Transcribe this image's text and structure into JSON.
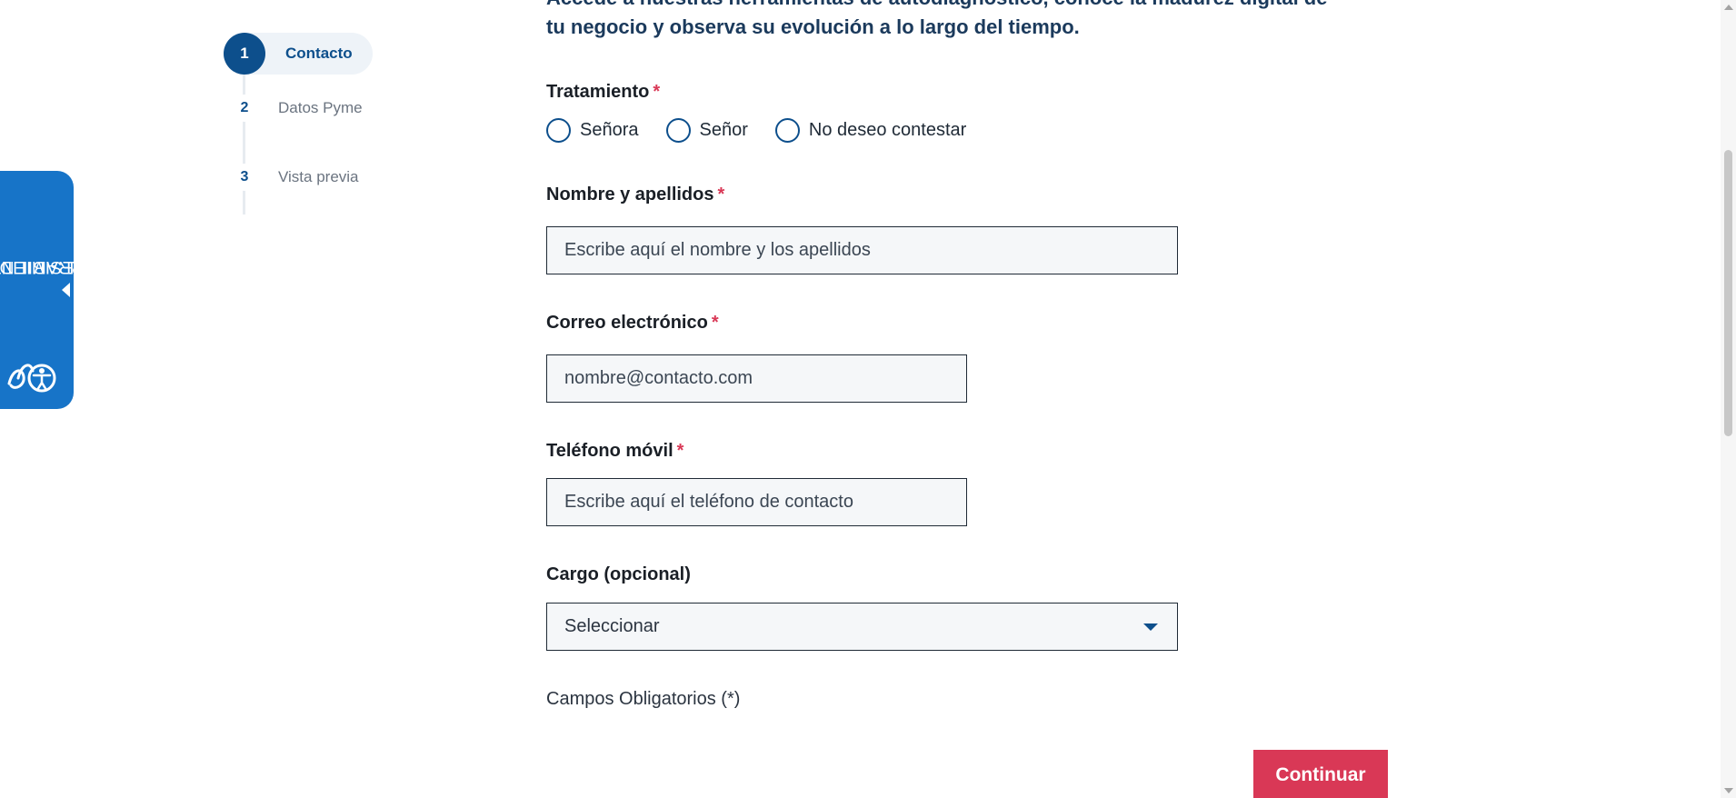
{
  "intro": {
    "line1": "Accede a nuestras herramientas de autodiagnóstico, conoce la madurez digital de",
    "line2": "tu negocio y observa su evolución a lo largo del tiempo."
  },
  "stepper": {
    "steps": [
      {
        "number": "1",
        "label": "Contacto",
        "state": "active"
      },
      {
        "number": "2",
        "label": "Datos Pyme",
        "state": "inactive"
      },
      {
        "number": "3",
        "label": "Vista previa",
        "state": "inactive"
      }
    ]
  },
  "accessibility": {
    "line1": "HERRAMIENTAS DE",
    "line2": "ACCESIBILIDAD",
    "logo_icon": "accessibility-person-icon",
    "arrow_icon": "caret-left-icon"
  },
  "form": {
    "required_marker": "*",
    "tratamiento": {
      "label": "Tratamiento",
      "options": [
        "Señora",
        "Señor",
        "No deseo contestar"
      ]
    },
    "nombre": {
      "label": "Nombre y apellidos",
      "placeholder": "Escribe aquí el nombre y los apellidos"
    },
    "correo": {
      "label": "Correo electrónico",
      "placeholder": "nombre@contacto.com"
    },
    "telefono": {
      "label": "Teléfono móvil",
      "placeholder": "Escribe aquí el teléfono de contacto"
    },
    "cargo": {
      "label": "Cargo (opcional)",
      "selected": "Seleccionar"
    },
    "required_note": "Campos Obligatorios (*)",
    "continue_label": "Continuar"
  },
  "colors": {
    "primary": "#0d4f8c",
    "accent": "#d93856",
    "a11y_blue": "#1774c8"
  }
}
